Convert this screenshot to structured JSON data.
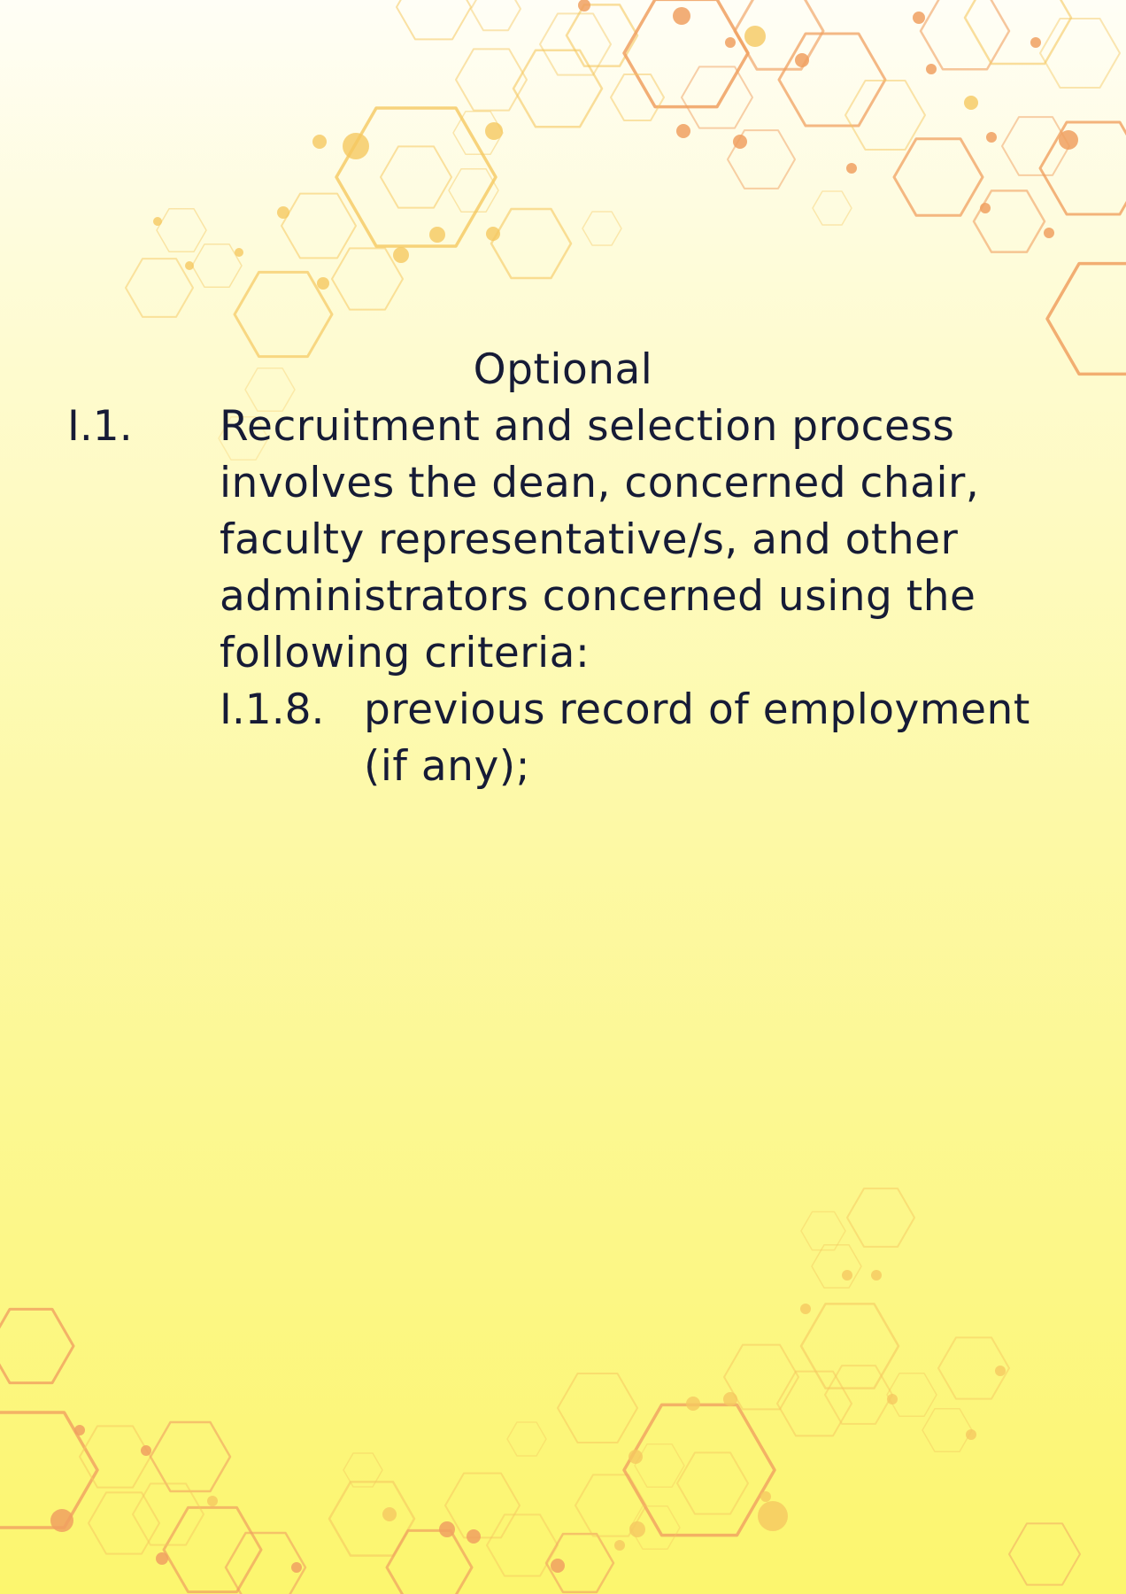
{
  "document": {
    "heading": "Optional",
    "section": {
      "number": "I.1.",
      "lines": [
        "Recruitment and selection process",
        "involves the dean, concerned chair,",
        "faculty representative/s, and other",
        "administrators concerned using the",
        "following criteria:"
      ]
    },
    "subsection": {
      "number": "I.1.8.",
      "lines": [
        "previous record of employment",
        "(if any);"
      ]
    }
  },
  "colors": {
    "text": "#161b36",
    "hex_orange": "#f0a060",
    "hex_gold": "#f5c860",
    "background_top": "#fffef6",
    "background_bottom": "#fcf66e"
  },
  "decoration": {
    "motif": "hexagon-network"
  }
}
